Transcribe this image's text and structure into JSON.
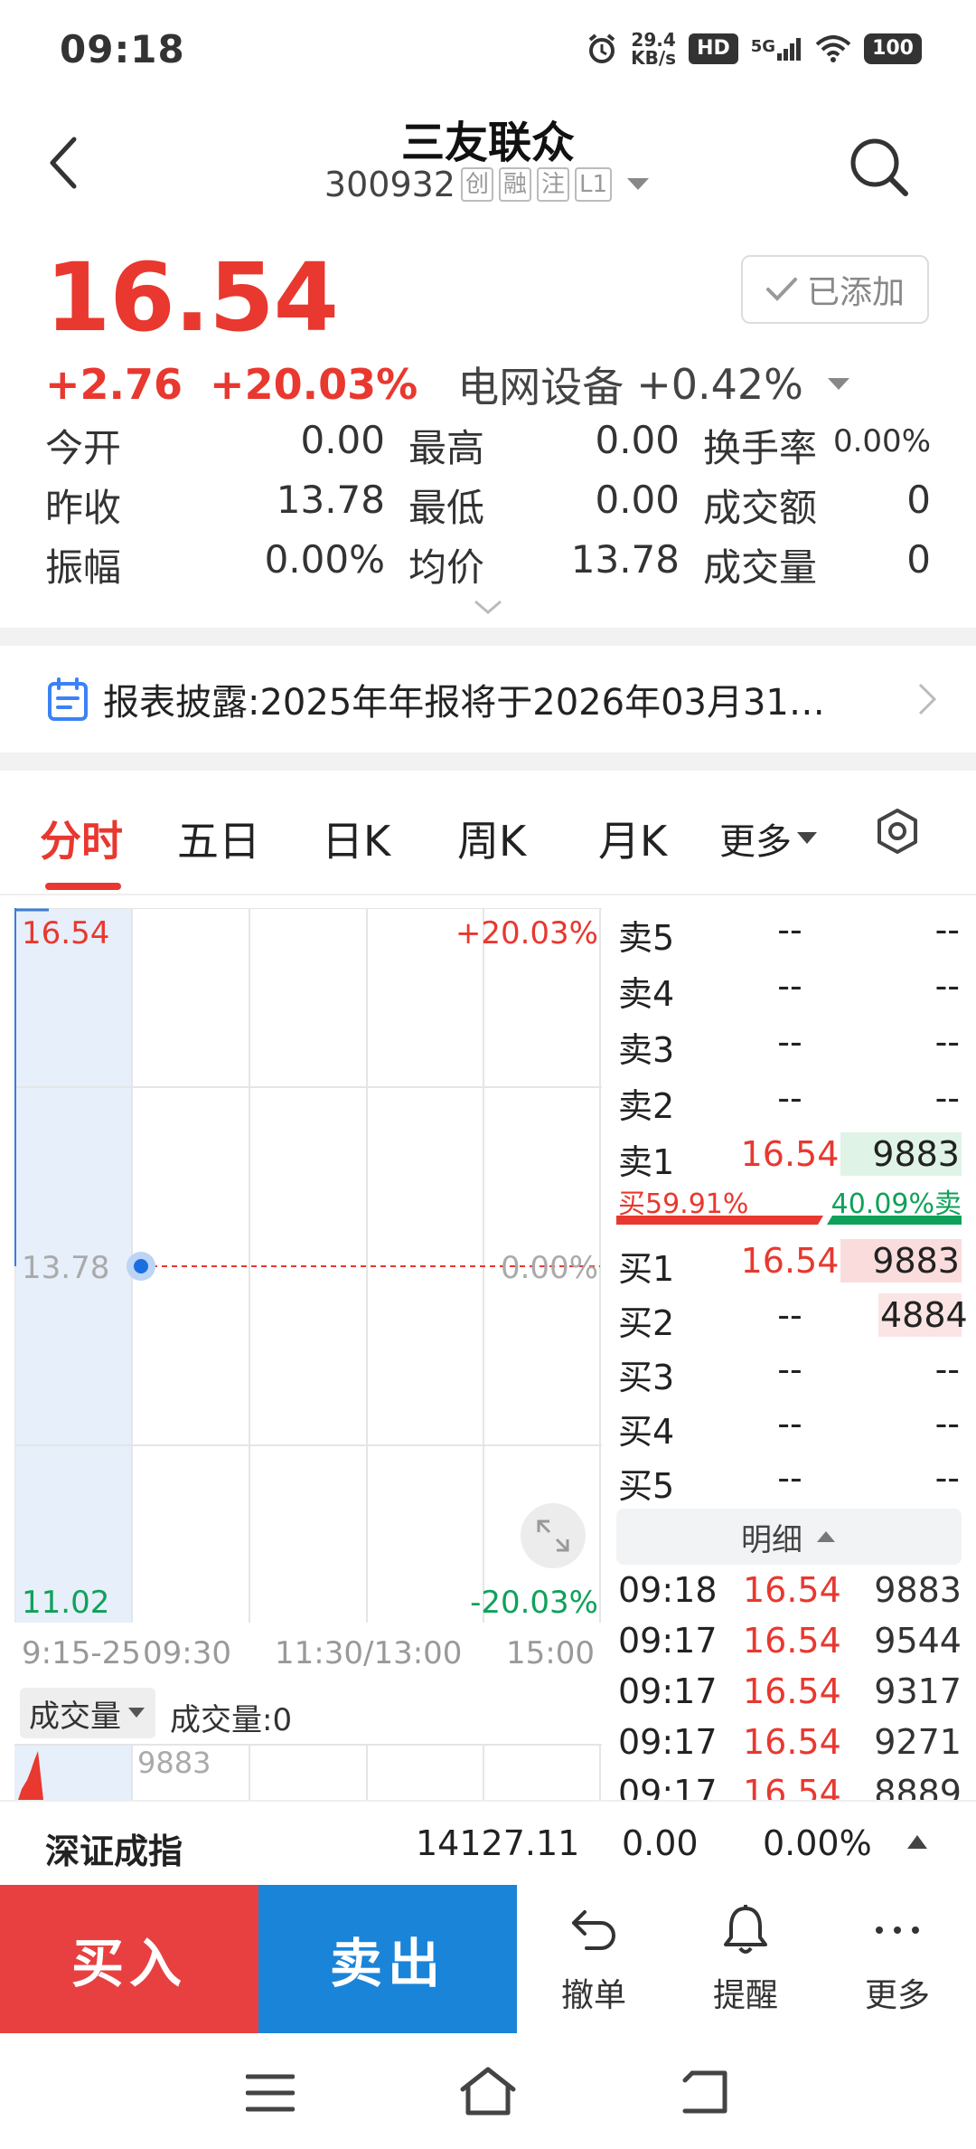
{
  "status_bar": {
    "time": "09:18",
    "speed_top": "29.4",
    "speed_bottom": "KB/s",
    "hd": "HD",
    "net": "5G",
    "battery": "100"
  },
  "header": {
    "title": "三友联众",
    "code": "300932",
    "tags": [
      "创",
      "融",
      "注",
      "L1"
    ]
  },
  "quote": {
    "price": "16.54",
    "change": "+2.76",
    "change_pct": "+20.03%",
    "sector_name": "电网设备",
    "sector_pct": "+0.42%",
    "added_label": "已添加"
  },
  "stats": [
    {
      "label": "今开",
      "value": "0.00"
    },
    {
      "label": "最高",
      "value": "0.00"
    },
    {
      "label": "换手率",
      "value": "0.00%"
    },
    {
      "label": "昨收",
      "value": "13.78"
    },
    {
      "label": "最低",
      "value": "0.00"
    },
    {
      "label": "成交额",
      "value": "0"
    },
    {
      "label": "振幅",
      "value": "0.00%"
    },
    {
      "label": "均价",
      "value": "13.78"
    },
    {
      "label": "成交量",
      "value": "0"
    }
  ],
  "notice": {
    "text": "报表披露:2025年年报将于2026年03月31…"
  },
  "tabs": [
    "分时",
    "五日",
    "日K",
    "周K",
    "月K",
    "更多"
  ],
  "chart_labels": {
    "price_high": "16.54",
    "pct_high": "+20.03%",
    "price_mid": "13.78",
    "pct_mid": "0.00%",
    "price_low": "11.02",
    "pct_low": "-20.03%",
    "time_ticks": [
      "9:15-25",
      "09:30",
      "11:30/13:00",
      "15:00"
    ],
    "volume_selector": "成交量",
    "volume_readout": "成交量:0",
    "volume_max": "9883"
  },
  "orderbook": {
    "asks": [
      {
        "label": "卖5",
        "price": "--",
        "vol": "--"
      },
      {
        "label": "卖4",
        "price": "--",
        "vol": "--"
      },
      {
        "label": "卖3",
        "price": "--",
        "vol": "--"
      },
      {
        "label": "卖2",
        "price": "--",
        "vol": "--"
      },
      {
        "label": "卖1",
        "price": "16.54",
        "vol": "9883"
      }
    ],
    "buy_ratio_label": "买59.91%",
    "sell_ratio_label": "40.09%卖",
    "buy_ratio": 0.5991,
    "bids": [
      {
        "label": "买1",
        "price": "16.54",
        "vol": "9883"
      },
      {
        "label": "买2",
        "price": "--",
        "vol": "4884"
      },
      {
        "label": "买3",
        "price": "--",
        "vol": "--"
      },
      {
        "label": "买4",
        "price": "--",
        "vol": "--"
      },
      {
        "label": "买5",
        "price": "--",
        "vol": "--"
      }
    ],
    "detail_label": "明细",
    "ticks": [
      {
        "time": "09:18",
        "price": "16.54",
        "vol": "9883"
      },
      {
        "time": "09:17",
        "price": "16.54",
        "vol": "9544"
      },
      {
        "time": "09:17",
        "price": "16.54",
        "vol": "9317"
      },
      {
        "time": "09:17",
        "price": "16.54",
        "vol": "9271"
      },
      {
        "time": "09:17",
        "price": "16.54",
        "vol": "8889"
      }
    ]
  },
  "index_bar": {
    "name": "深证成指",
    "value": "14127.11",
    "change": "0.00",
    "pct": "0.00%"
  },
  "actions": {
    "buy": "买入",
    "sell": "卖出",
    "cancel": "撤单",
    "alert": "提醒",
    "more": "更多"
  },
  "colors": {
    "up": "#e8382f",
    "down": "#0fa15a",
    "buy_button": "#e84040",
    "sell_button": "#1a84d9"
  }
}
